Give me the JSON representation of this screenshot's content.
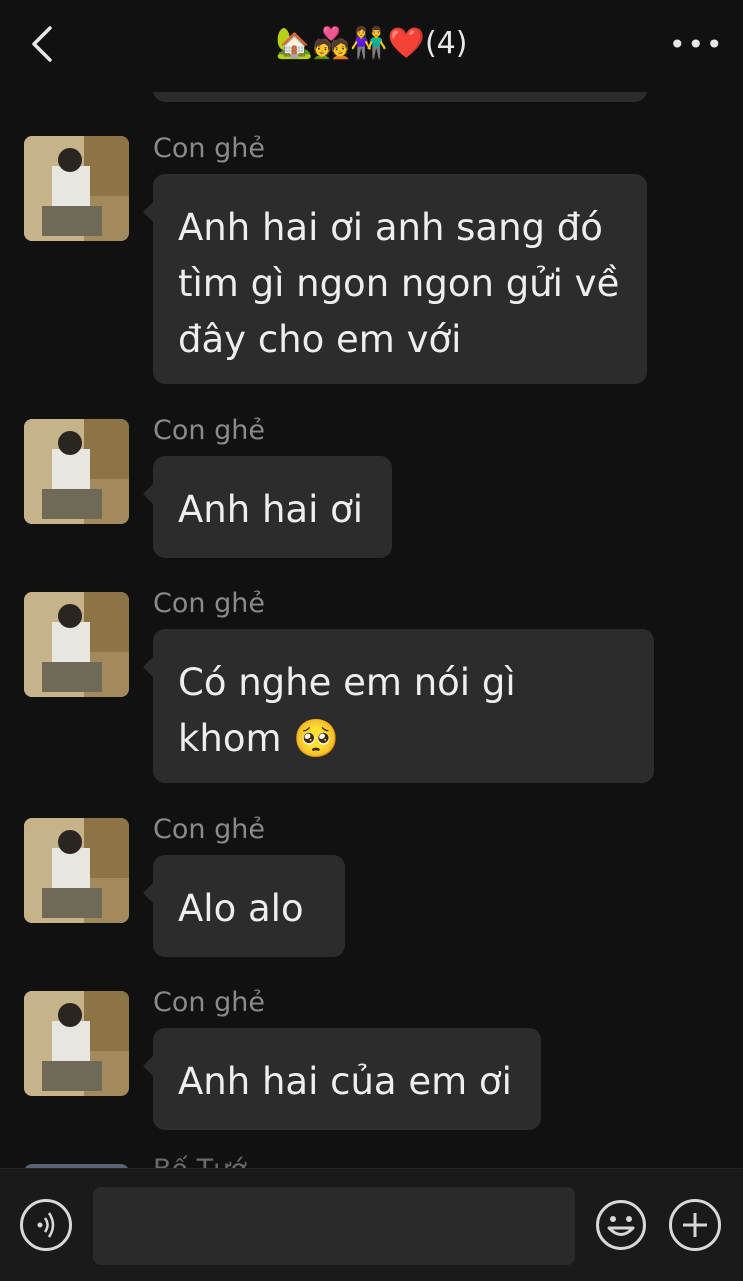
{
  "header": {
    "title": "🏡💑👫❤️(4)",
    "back_icon": "chevron-left-icon",
    "more_icon": "more-dots-icon",
    "more_label": "•••"
  },
  "messages": [
    {
      "sender": "Con ghẻ",
      "text": "Anh hai ơi anh sang đó tìm gì ngon ngon gửi về đây cho em với"
    },
    {
      "sender": "Con ghẻ",
      "text": "Anh hai ơi"
    },
    {
      "sender": "Con ghẻ",
      "text": "Có nghe em nói gì khom 🥺"
    },
    {
      "sender": "Con ghẻ",
      "text": "Alo alo"
    },
    {
      "sender": "Con ghẻ",
      "text": "Anh hai của em ơi"
    }
  ],
  "peek_sender": "Bố Tướ",
  "footer": {
    "voice_icon": "voice-icon",
    "emoji_icon": "smiley-icon",
    "plus_icon": "plus-icon",
    "input_value": ""
  },
  "colors": {
    "background": "#111111",
    "bubble": "#2c2c2c",
    "sender": "#8a8a8a"
  }
}
